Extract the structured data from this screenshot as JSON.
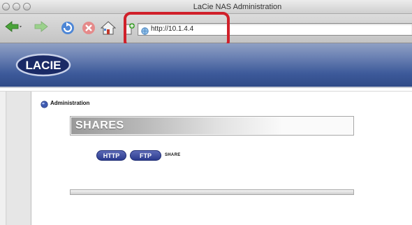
{
  "window": {
    "title": "LaCie NAS Administration"
  },
  "toolbar": {
    "buttons": [
      "back-icon",
      "forward-icon",
      "reload-icon",
      "stop-icon",
      "home-icon",
      "bookmark-icon"
    ],
    "url": "http://10.1.4.4"
  },
  "header": {
    "logo_text": "LACIE"
  },
  "breadcrumb": {
    "label": "Administration"
  },
  "shares": {
    "title": "SHARES",
    "tabs": [
      {
        "label": "HTTP"
      },
      {
        "label": "FTP"
      }
    ],
    "share_label": "SHARE"
  },
  "colors": {
    "header_blue": "#3d5a9a",
    "pill_blue": "#2b3b8e",
    "highlight_red": "#d0202a"
  }
}
